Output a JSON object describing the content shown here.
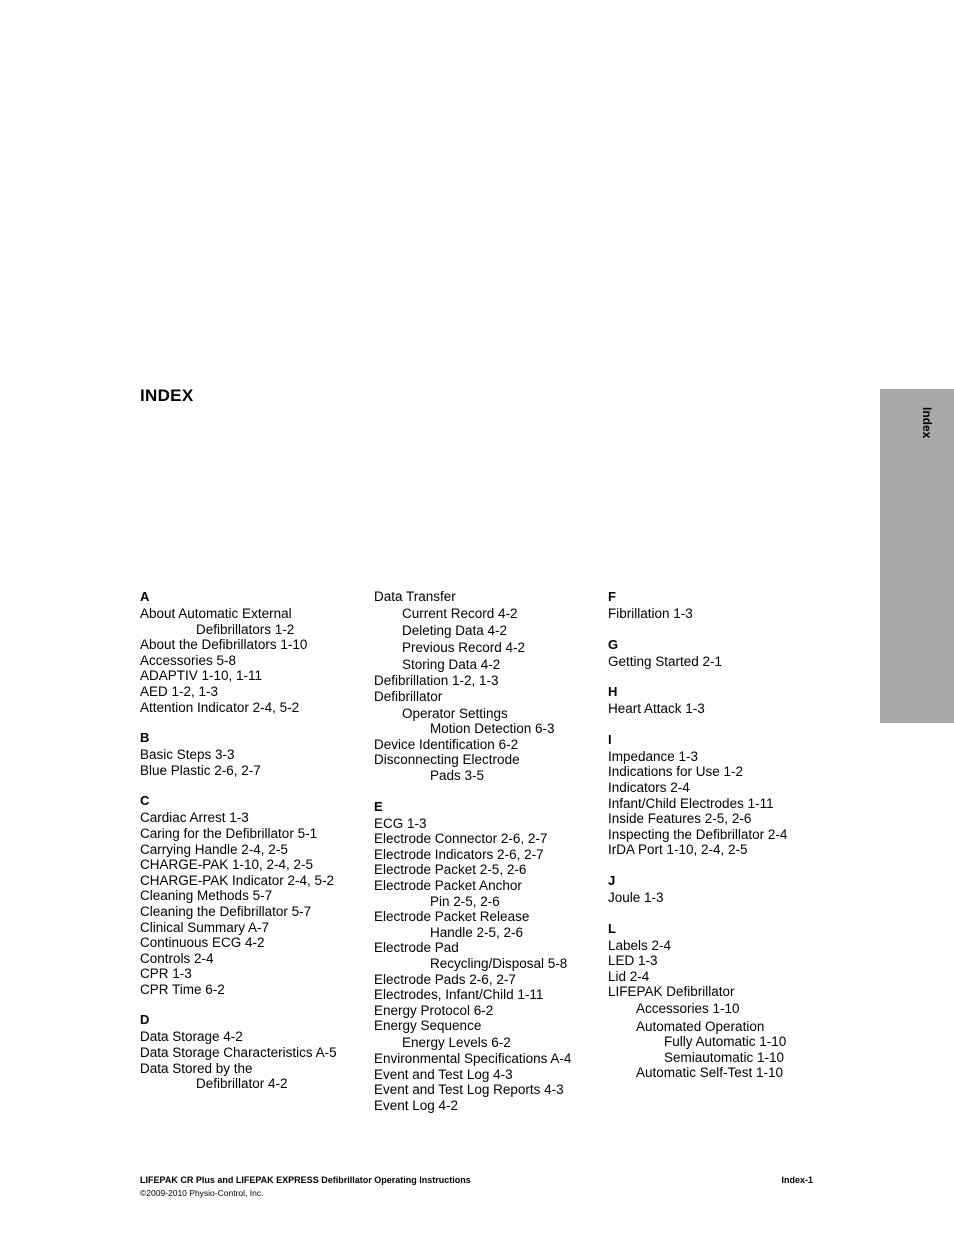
{
  "page": {
    "title": "INDEX",
    "side_tab_label": "Index",
    "side_tab_color": "#a8a8a8"
  },
  "columns": [
    {
      "sections": [
        {
          "letter": "A",
          "entries": [
            {
              "text": "About Automatic External",
              "level": 0
            },
            {
              "text": "Defibrillators 1-2",
              "level": 2
            },
            {
              "text": "About the Defibrillators 1-10",
              "level": 0
            },
            {
              "text": "Accessories 5-8",
              "level": 0
            },
            {
              "text": "ADAPTIV 1-10, 1-11",
              "level": 0
            },
            {
              "text": "AED 1-2, 1-3",
              "level": 0
            },
            {
              "text": "Attention Indicator 2-4, 5-2",
              "level": 0
            }
          ]
        },
        {
          "letter": "B",
          "entries": [
            {
              "text": "Basic Steps 3-3",
              "level": 0
            },
            {
              "text": "Blue Plastic 2-6, 2-7",
              "level": 0
            }
          ]
        },
        {
          "letter": "C",
          "entries": [
            {
              "text": "Cardiac Arrest 1-3",
              "level": 0
            },
            {
              "text": "Caring for the Defibrillator 5-1",
              "level": 0
            },
            {
              "text": "Carrying Handle 2-4, 2-5",
              "level": 0
            },
            {
              "text": "CHARGE-PAK 1-10, 2-4, 2-5",
              "level": 0
            },
            {
              "text": "CHARGE-PAK Indicator 2-4, 5-2",
              "level": 0
            },
            {
              "text": "Cleaning Methods 5-7",
              "level": 0
            },
            {
              "text": "Cleaning the Defibrillator 5-7",
              "level": 0
            },
            {
              "text": "Clinical Summary A-7",
              "level": 0
            },
            {
              "text": "Continuous ECG 4-2",
              "level": 0
            },
            {
              "text": "Controls 2-4",
              "level": 0
            },
            {
              "text": "CPR 1-3",
              "level": 0
            },
            {
              "text": "CPR Time 6-2",
              "level": 0
            }
          ]
        },
        {
          "letter": "D",
          "entries": [
            {
              "text": "Data Storage 4-2",
              "level": 0
            },
            {
              "text": "Data Storage Characteristics A-5",
              "level": 0
            },
            {
              "text": "Data Stored by the",
              "level": 0
            },
            {
              "text": "Defibrillator 4-2",
              "level": 2
            }
          ]
        }
      ]
    },
    {
      "sections": [
        {
          "letter": "",
          "entries": [
            {
              "text": "Data Transfer",
              "level": 0
            },
            {
              "text": "Current Record 4-2",
              "level": 1
            },
            {
              "text": "Deleting Data 4-2",
              "level": 1
            },
            {
              "text": "Previous Record 4-2",
              "level": 1
            },
            {
              "text": "Storing Data 4-2",
              "level": 1
            },
            {
              "text": "Defibrillation 1-2, 1-3",
              "level": 0
            },
            {
              "text": "Defibrillator",
              "level": 0
            },
            {
              "text": "Operator Settings",
              "level": 1
            },
            {
              "text": "Motion Detection 6-3",
              "level": 2
            },
            {
              "text": "Device Identification 6-2",
              "level": 0
            },
            {
              "text": "Disconnecting Electrode",
              "level": 0
            },
            {
              "text": "Pads 3-5",
              "level": 2
            }
          ]
        },
        {
          "letter": "E",
          "entries": [
            {
              "text": "ECG 1-3",
              "level": 0
            },
            {
              "text": "Electrode Connector 2-6, 2-7",
              "level": 0
            },
            {
              "text": "Electrode Indicators 2-6, 2-7",
              "level": 0
            },
            {
              "text": "Electrode Packet 2-5, 2-6",
              "level": 0
            },
            {
              "text": "Electrode Packet Anchor",
              "level": 0
            },
            {
              "text": "Pin 2-5, 2-6",
              "level": 2
            },
            {
              "text": "Electrode Packet Release",
              "level": 0
            },
            {
              "text": "Handle 2-5, 2-6",
              "level": 2
            },
            {
              "text": "Electrode Pad",
              "level": 0
            },
            {
              "text": "Recycling/Disposal 5-8",
              "level": 2
            },
            {
              "text": "Electrode Pads 2-6, 2-7",
              "level": 0
            },
            {
              "text": "Electrodes, Infant/Child 1-11",
              "level": 0
            },
            {
              "text": "Energy Protocol 6-2",
              "level": 0
            },
            {
              "text": "Energy Sequence",
              "level": 0
            },
            {
              "text": "Energy Levels 6-2",
              "level": 1
            },
            {
              "text": "Environmental Specifications A-4",
              "level": 0
            },
            {
              "text": "Event and Test Log 4-3",
              "level": 0
            },
            {
              "text": "Event and Test Log Reports 4-3",
              "level": 0
            },
            {
              "text": "Event Log 4-2",
              "level": 0
            }
          ]
        }
      ]
    },
    {
      "sections": [
        {
          "letter": "F",
          "entries": [
            {
              "text": "Fibrillation 1-3",
              "level": 0
            }
          ]
        },
        {
          "letter": "G",
          "entries": [
            {
              "text": "Getting Started 2-1",
              "level": 0
            }
          ]
        },
        {
          "letter": "H",
          "entries": [
            {
              "text": "Heart Attack 1-3",
              "level": 0
            }
          ]
        },
        {
          "letter": "I",
          "entries": [
            {
              "text": "Impedance 1-3",
              "level": 0
            },
            {
              "text": "Indications for Use 1-2",
              "level": 0
            },
            {
              "text": "Indicators 2-4",
              "level": 0
            },
            {
              "text": "Infant/Child Electrodes 1-11",
              "level": 0
            },
            {
              "text": "Inside Features 2-5, 2-6",
              "level": 0
            },
            {
              "text": "Inspecting the Defibrillator 2-4",
              "level": 0
            },
            {
              "text": "IrDA Port 1-10, 2-4, 2-5",
              "level": 0
            }
          ]
        },
        {
          "letter": "J",
          "entries": [
            {
              "text": "Joule 1-3",
              "level": 0
            }
          ]
        },
        {
          "letter": "L",
          "entries": [
            {
              "text": "Labels 2-4",
              "level": 0
            },
            {
              "text": "LED 1-3",
              "level": 0
            },
            {
              "text": "Lid 2-4",
              "level": 0
            },
            {
              "text": "LIFEPAK Defibrillator",
              "level": 0
            },
            {
              "text": "Accessories 1-10",
              "level": 1
            },
            {
              "text": "Automated Operation",
              "level": 1
            },
            {
              "text": "Fully Automatic 1-10",
              "level": 2
            },
            {
              "text": "Semiautomatic 1-10",
              "level": 2
            },
            {
              "text": "Automatic Self-Test 1-10",
              "level": 1
            }
          ]
        }
      ]
    }
  ],
  "footer": {
    "document_title": "LIFEPAK CR Plus and LIFEPAK EXPRESS Defibrillator Operating Instructions",
    "copyright": "©2009-2010 Physio-Control, Inc.",
    "page_number": "Index-1"
  }
}
